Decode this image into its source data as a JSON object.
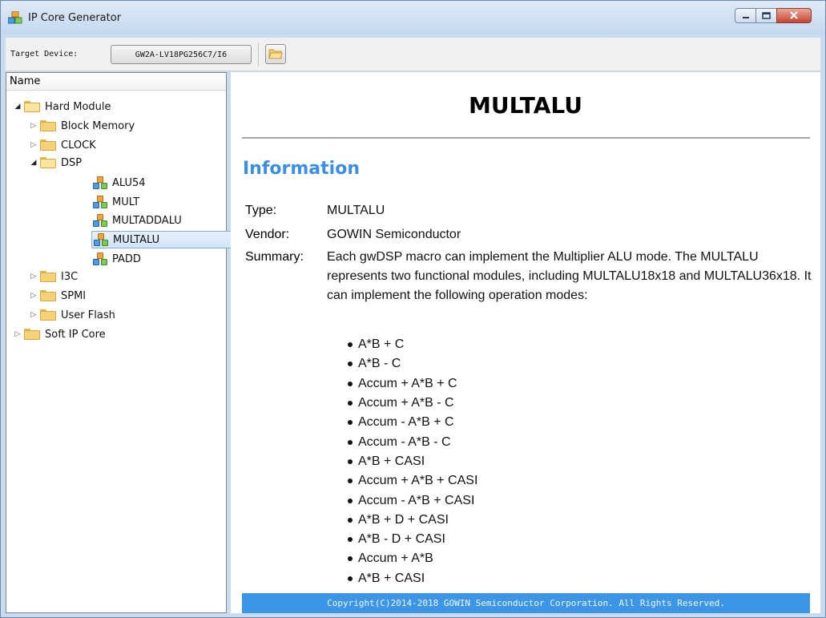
{
  "window": {
    "title": "IP Core Generator",
    "buttons": {
      "minimize": "minimize-icon",
      "maximize": "maximize-icon",
      "close": "close-icon"
    }
  },
  "toolbar": {
    "target_label": "Target Device:",
    "target_value": "GW2A-LV18PG256C7/I6",
    "open_icon": "folder-open-icon"
  },
  "tree": {
    "header": "Name",
    "items": [
      {
        "label": "Hard Module",
        "level": 0,
        "expanded": true,
        "kind": "folder"
      },
      {
        "label": "Block Memory",
        "level": 1,
        "expanded": false,
        "kind": "folder"
      },
      {
        "label": "CLOCK",
        "level": 1,
        "expanded": false,
        "kind": "folder"
      },
      {
        "label": "DSP",
        "level": 1,
        "expanded": true,
        "kind": "folder"
      },
      {
        "label": "ALU54",
        "level": 2,
        "kind": "ip"
      },
      {
        "label": "MULT",
        "level": 2,
        "kind": "ip"
      },
      {
        "label": "MULTADDALU",
        "level": 2,
        "kind": "ip"
      },
      {
        "label": "MULTALU",
        "level": 2,
        "kind": "ip",
        "selected": true
      },
      {
        "label": "PADD",
        "level": 2,
        "kind": "ip"
      },
      {
        "label": "I3C",
        "level": 1,
        "expanded": false,
        "kind": "folder"
      },
      {
        "label": "SPMI",
        "level": 1,
        "expanded": false,
        "kind": "folder"
      },
      {
        "label": "User Flash",
        "level": 1,
        "expanded": false,
        "kind": "folder"
      },
      {
        "label": "Soft IP Core",
        "level": 0,
        "expanded": false,
        "kind": "folder"
      }
    ]
  },
  "doc": {
    "title": "MULTALU",
    "section": "Information",
    "type_label": "Type:",
    "type_value": "MULTALU",
    "vendor_label": "Vendor:",
    "vendor_value": "GOWIN Semiconductor",
    "summary_label": "Summary:",
    "summary_text": "Each gwDSP macro can implement the Multiplier ALU mode. The MULTALU represents two functional modules, including MULTALU18x18 and MULTALU36x18. It can implement the following operation modes:",
    "modes": [
      "A*B + C",
      "A*B - C",
      "Accum + A*B + C",
      "Accum + A*B - C",
      "Accum - A*B + C",
      "Accum - A*B - C",
      "A*B + CASI",
      "Accum + A*B + CASI",
      "Accum - A*B + CASI",
      "A*B + D + CASI",
      "A*B - D + CASI",
      "Accum + A*B",
      "A*B + CASI"
    ],
    "footer": "Copyright(C)2014-2018 GOWIN Semiconductor Corporation. All Rights Reserved."
  },
  "colors": {
    "accent": "#3a8ee6",
    "footer_bg": "#3d95e6",
    "selection_border": "#84acdd"
  }
}
